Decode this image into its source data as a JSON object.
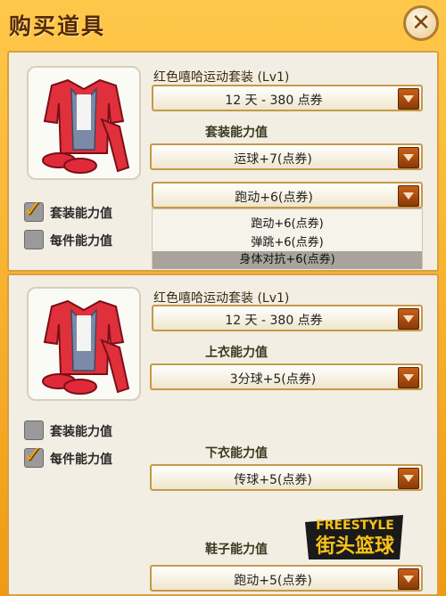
{
  "window": {
    "title": "购买道具"
  },
  "set1": {
    "item_name": "红色嘻哈运动套装 (Lv1)",
    "price_select": "12 天 - 380 点券",
    "section_label": "套装能力值",
    "ability_select_1": "运球+7(点券)",
    "ability_select_2": "跑动+6(点券)",
    "ability_options": [
      "跑动+6(点券)",
      "弹跳+6(点券)",
      "身体对抗+6(点券)"
    ],
    "check_set_label": "套装能力值",
    "check_piece_label": "每件能力值",
    "check_set_checked": true,
    "check_piece_checked": false
  },
  "set2": {
    "item_name": "红色嘻哈运动套装 (Lv1)",
    "price_select": "12 天 - 380 点券",
    "top_label": "上衣能力值",
    "top_select": "3分球+5(点券)",
    "bottom_label": "下衣能力值",
    "bottom_select": "传球+5(点券)",
    "shoes_label": "鞋子能力值",
    "shoes_select": "跑动+5(点券)",
    "check_set_label": "套装能力值",
    "check_piece_label": "每件能力值",
    "check_set_checked": false,
    "check_piece_checked": true
  },
  "logo": {
    "text_top": "FREESTYLE",
    "text_bottom": "街头篮球"
  },
  "colors": {
    "accent": "#f5a623",
    "outfit_red": "#e0303c",
    "dropdown_arrow": "#b04c10"
  }
}
